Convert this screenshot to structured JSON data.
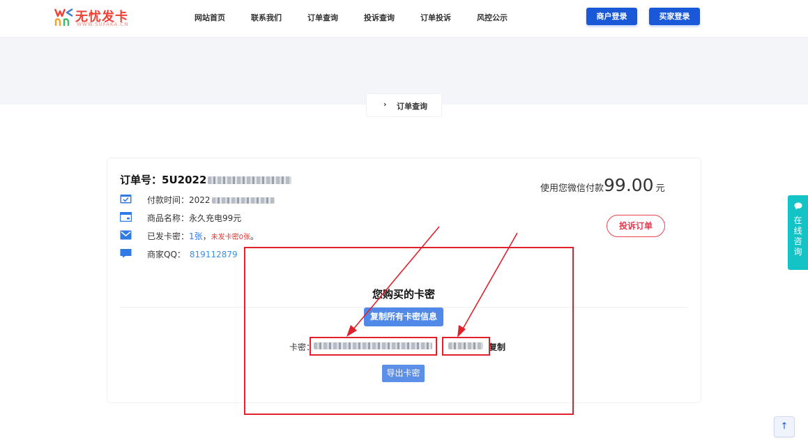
{
  "header": {
    "logo_text": "无忧发卡",
    "logo_sub": "WWW.SUFAKA.CN",
    "nav": [
      {
        "label": "网站首页"
      },
      {
        "label": "联系我们"
      },
      {
        "label": "订单查询"
      },
      {
        "label": "投诉查询"
      },
      {
        "label": "订单投诉"
      },
      {
        "label": "风控公示"
      }
    ],
    "merchant_login": "商户登录",
    "buyer_login": "买家登录"
  },
  "breadcrumb": {
    "chevron": "›",
    "label": "订单查询"
  },
  "order": {
    "number_label": "订单号：",
    "number_visible": "5U2022",
    "pay_time_label": "付款时间：",
    "pay_time_visible": "2022",
    "product_label": "商品名称：",
    "product_value": "永久充电99元",
    "sent_label": "已发卡密：",
    "sent_count": "1张",
    "sent_sep": "，",
    "unsent_text": "未发卡密0张",
    "sent_end": "。",
    "qq_label": "商家QQ：",
    "qq_value": "819112879",
    "pay_prefix": "使用您微信付款",
    "pay_amount": "99.00",
    "pay_unit": "元",
    "complain_button": "投诉订单"
  },
  "cards": {
    "title": "您购买的卡密",
    "copy_all_button": "复制所有卡密信息",
    "kami_label": "卡密：",
    "copy_link": "复制",
    "export_button": "导出卡密"
  },
  "side": {
    "consult_text": "在线咨询"
  },
  "colors": {
    "brand_red": "#ee4035",
    "primary_blue": "#1958d6",
    "accent_teal": "#13c3c6",
    "annotation_red": "#e0202a"
  }
}
